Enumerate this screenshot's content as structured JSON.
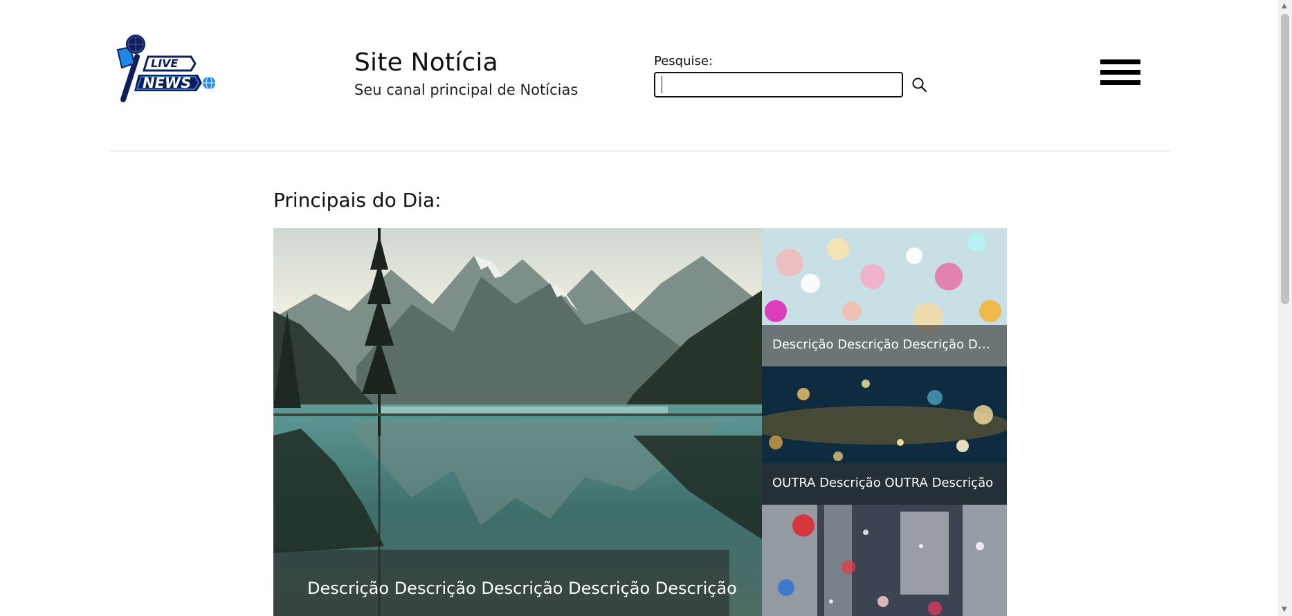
{
  "header": {
    "logo_text_top": "LIVE",
    "logo_text_bottom": "NEWS",
    "site_title": "Site Notícia",
    "site_subtitle": "Seu canal principal de Notícias",
    "search_label": "Pesquise:",
    "search_value": "",
    "search_icon": "search-icon",
    "menu_icon": "hamburger-menu-icon"
  },
  "section": {
    "title": "Principais do Dia:"
  },
  "cards": [
    {
      "caption": "Descrição Descrição Descrição Descrição Descrição",
      "image": "mountain-lake"
    },
    {
      "caption": "Descrição Descrição Descrição Descrição",
      "image": "colorful-bokeh"
    },
    {
      "caption": "OUTRA Descrição OUTRA Descrição",
      "image": "golden-bokeh"
    },
    {
      "caption": "",
      "image": "rain-drops"
    }
  ],
  "colors": {
    "accent_blue": "#1a5fc8",
    "logo_navy": "#0c1f5a",
    "caption_overlay": "#323232"
  }
}
